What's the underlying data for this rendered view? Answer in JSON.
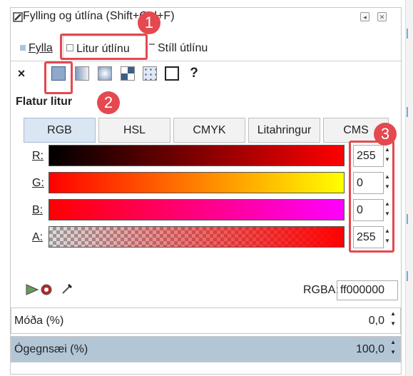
{
  "dialog": {
    "title": "Fylling og útlína (Shift+Ctrl+F)",
    "tabs": [
      {
        "label": "Fylla",
        "active": false
      },
      {
        "label": "Litur útlínu",
        "active": true
      },
      {
        "label": "Stíll útlínu",
        "active": false
      }
    ]
  },
  "paint_types": [
    "no-paint",
    "flat-color",
    "linear-gradient",
    "radial-gradient",
    "pattern",
    "swatch",
    "unset"
  ],
  "section_title": "Flatur litur",
  "color_modes": [
    {
      "label": "RGB",
      "selected": true
    },
    {
      "label": "HSL",
      "selected": false
    },
    {
      "label": "CMYK",
      "selected": false
    },
    {
      "label": "Litahringur",
      "selected": false
    },
    {
      "label": "CMS",
      "selected": false
    }
  ],
  "channels": [
    {
      "label": "R:",
      "value": "255"
    },
    {
      "label": "G:",
      "value": "0"
    },
    {
      "label": "B:",
      "value": "0"
    },
    {
      "label": "A:",
      "value": "255"
    }
  ],
  "rgba": {
    "label": "RGBA:",
    "value": "ff000000"
  },
  "blur": {
    "label": "Móða (%)",
    "value": "0,0"
  },
  "opacity": {
    "label": "Ógegnsæi (%)",
    "value": "100,0",
    "fraction": 1.0
  },
  "badges": [
    "1",
    "2",
    "3"
  ],
  "colors": {
    "annotation": "#e3494f",
    "selected_mode": "#dbe6f3",
    "accent": "#4a7ebb"
  }
}
